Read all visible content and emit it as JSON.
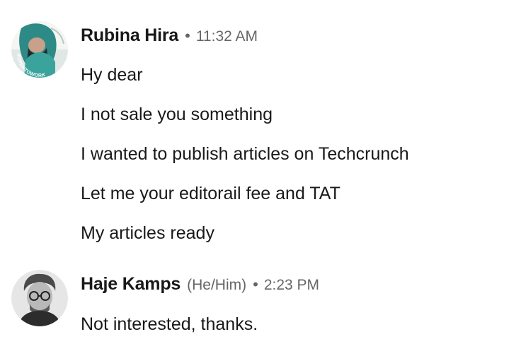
{
  "messages": [
    {
      "sender": "Rubina Hira",
      "time": "11:32 AM",
      "avatar_badge": "#OPENTOWORK",
      "lines": [
        "Hy dear",
        "I not sale you something",
        "I wanted to publish articles on Techcrunch",
        "Let me your editorail fee and TAT",
        "My articles ready"
      ]
    },
    {
      "sender": "Haje Kamps",
      "pronouns": "(He/Him)",
      "time": "2:23 PM",
      "lines": [
        "Not interested, thanks."
      ]
    }
  ],
  "separator": "•",
  "colors": {
    "opentowork_ring": "#3b7d3e",
    "meta_text": "#666666",
    "body_text": "#191919"
  }
}
